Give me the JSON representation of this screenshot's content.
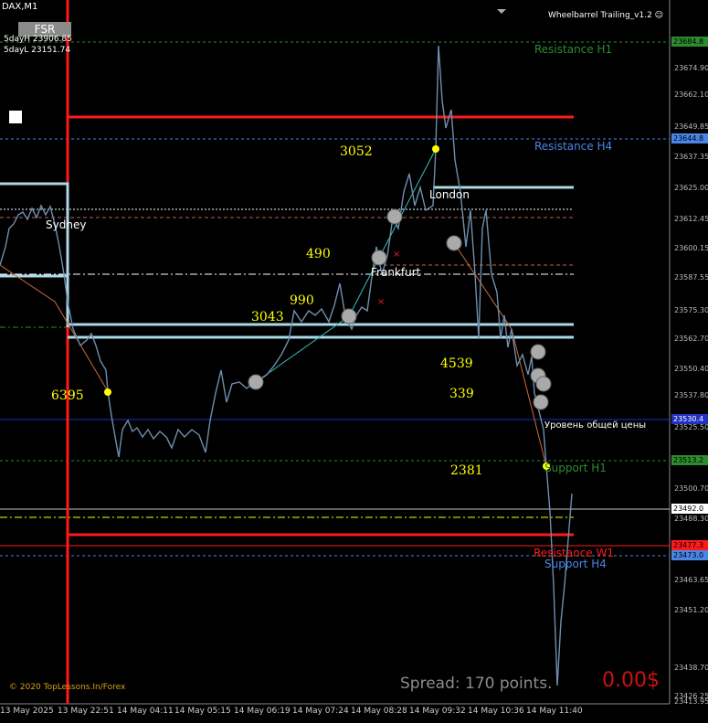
{
  "header": {
    "symbol": "DAX,M1",
    "ea_name": "Wheelbarrel Trailing_v1.2"
  },
  "indicator": {
    "button": "FSR",
    "day_high": "5dayH 23906.85",
    "day_low": "5dayL 23151.74"
  },
  "levels": {
    "resistance_h1": "Resistance H1",
    "resistance_h4": "Resistance H4",
    "resistance_w1": "Resistance W1",
    "support_h1": "Support H1",
    "support_h4": "Support H4",
    "general_price": "Уровень общей цены"
  },
  "sessions": {
    "sydney": "Sydney",
    "london": "London",
    "frankfurt": "Frankfurt"
  },
  "pip_labels": [
    "3052",
    "490",
    "990",
    "3043",
    "6395",
    "4539",
    "339",
    "2381"
  ],
  "price_axis": [
    "23684.8",
    "23674.90",
    "23662.10",
    "23649.85",
    "23644.8",
    "23637.35",
    "23625.00",
    "23612.45",
    "23600.15",
    "23587.55",
    "23575.30",
    "23562.70",
    "23550.40",
    "23537.80",
    "23525.50",
    "23513.2",
    "23500.70",
    "23492.0",
    "23488.30",
    "23477.3",
    "23473.0",
    "23463.65",
    "23451.20",
    "23438.70",
    "23426.25",
    "23413.95"
  ],
  "price_tags": {
    "resistance_h1": "23684.8",
    "resistance_h4": "23644.8",
    "general": "23530.4",
    "support_h1": "23513.2",
    "current": "23492.0",
    "resistance_w1": "23477.3",
    "support_h4": "23473.0"
  },
  "time_axis": [
    "13 May 2025",
    "13 May 22:51",
    "14 May 04:11",
    "14 May 05:15",
    "14 May 06:19",
    "14 May 07:24",
    "14 May 08:28",
    "14 May 09:32",
    "14 May 10:36",
    "14 May 11:40"
  ],
  "footer": {
    "copyright": "© 2020 TopLessons.In/Forex",
    "spread": "Spread: 170 points.",
    "profit": "0.00$"
  },
  "colors": {
    "background": "#000000",
    "resistance_red": "#ff1a1a",
    "session_box": "#add8e6",
    "h4_blue": "#4a86e8",
    "support_green": "#2e8b2e",
    "label_yellow": "#ffff00",
    "price_line": "#6f8faf"
  }
}
